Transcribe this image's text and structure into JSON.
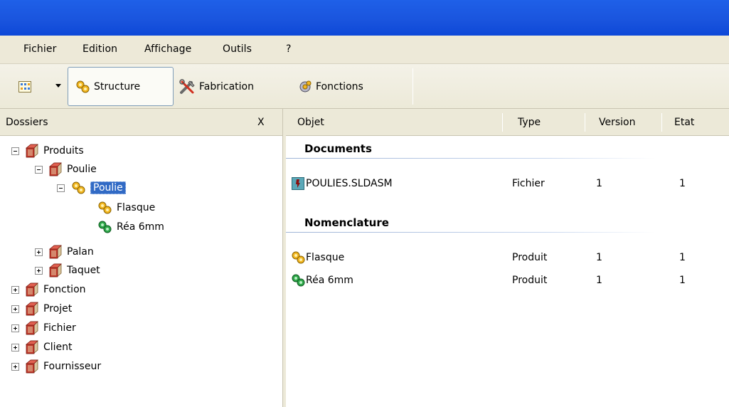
{
  "window": {
    "title": ""
  },
  "menu": {
    "items": [
      "Fichier",
      "Edition",
      "Affichage",
      "Outils",
      "?"
    ]
  },
  "toolbar": {
    "structure_label": "Structure",
    "fabrication_label": "Fabrication",
    "fonctions_label": "Fonctions"
  },
  "folders": {
    "title": "Dossiers",
    "close_label": "X",
    "tree": {
      "produits": "Produits",
      "poulie_folder": "Poulie",
      "poulie_product": "Poulie",
      "flasque": "Flasque",
      "rea": "Réa 6mm",
      "palan": "Palan",
      "taquet": "Taquet",
      "fonction": "Fonction",
      "projet": "Projet",
      "fichier": "Fichier",
      "client": "Client",
      "fournisseur": "Fournisseur"
    }
  },
  "list": {
    "columns": {
      "objet": "Objet",
      "type": "Type",
      "version": "Version",
      "etat": "Etat"
    },
    "documents": {
      "title": "Documents",
      "rows": [
        {
          "objet": "POULIES.SLDASM",
          "type": "Fichier",
          "version": "1",
          "etat": "1"
        }
      ]
    },
    "nomenclature": {
      "title": "Nomenclature",
      "rows": [
        {
          "objet": "Flasque",
          "type": "Produit",
          "version": "1",
          "etat": "1"
        },
        {
          "objet": "Réa 6mm",
          "type": "Produit",
          "version": "1",
          "etat": "1"
        }
      ]
    }
  },
  "colors": {
    "titlebar": "#1a55de",
    "selection": "#316ac5",
    "chrome": "#ece9d8"
  }
}
